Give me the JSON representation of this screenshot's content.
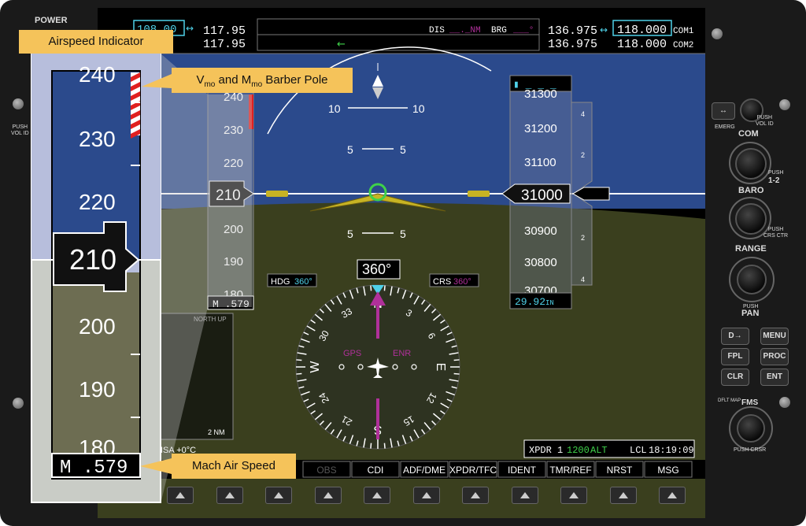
{
  "panel": {
    "power_label": "POWER",
    "push_vol_id_left": "PUSH\nVOL ID",
    "emerg_label": "EMERG",
    "push_vol_id_right": "PUSH\nVOL ID",
    "com_label": "COM",
    "push_1_2": "PUSH",
    "one_two": "1-2",
    "baro_label": "BARO",
    "push_crs_ctr": "PUSH\nCRS CTR",
    "range_label": "RANGE",
    "push_label": "PUSH",
    "pan_label": "PAN",
    "dflt_map": "DFLT MAP",
    "fms_label": "FMS",
    "push_crsr": "PUSH CRSR",
    "buttons": {
      "direct": "D→",
      "menu": "MENU",
      "fpl": "FPL",
      "proc": "PROC",
      "clr": "CLR",
      "ent": "ENT"
    }
  },
  "nav_bar": {
    "nav_active": "108.00",
    "nav1_standby": "117.95",
    "nav2_standby": "117.95",
    "dis_label": "DIS",
    "dis_value": "__._NM",
    "brg_label": "BRG",
    "brg_value": "___°",
    "com1_standby": "136.975",
    "com1_active": "118.000",
    "com1_label": "COM1",
    "com2_standby": "136.975",
    "com2_active": "118.000",
    "com2_label": "COM2"
  },
  "attitude": {
    "pitch_marks": [
      "10",
      "10",
      "5",
      "5",
      "5",
      "5"
    ]
  },
  "airspeed_tape": {
    "ticks": [
      "240",
      "230",
      "220",
      "200",
      "190",
      "180"
    ],
    "current": "210",
    "mach": "M .579"
  },
  "altitude_tape": {
    "selected": "_ _ _",
    "ticks": [
      "31300",
      "31200",
      "31100",
      "30900",
      "30800",
      "30700"
    ],
    "current": "31000",
    "baro": "29.92",
    "baro_unit": "IN",
    "vsi_ticks": [
      "4",
      "2",
      "2",
      "4"
    ]
  },
  "hsi": {
    "heading": "360°",
    "hdg_label": "HDG",
    "hdg_value": "360°",
    "crs_label": "CRS",
    "crs_value": "360°",
    "gps_label": "GPS",
    "enr_label": "ENR",
    "card": [
      "N",
      "3",
      "6",
      "E",
      "12",
      "15",
      "S",
      "21",
      "24",
      "W",
      "30",
      "33"
    ]
  },
  "inset_map": {
    "orientation": "NORTH UP",
    "range": "2 NM"
  },
  "status_bar": {
    "xpdr": "XPDR 1",
    "code": "1200",
    "mode": "ALT",
    "lcl_label": "LCL",
    "time": "18:19:09",
    "isa": "ISA",
    "temp": "+0°C"
  },
  "softkeys": [
    "OBS",
    "CDI",
    "ADF/DME",
    "XPDR/TFC",
    "IDENT",
    "TMR/REF",
    "NRST",
    "MSG"
  ],
  "callouts": {
    "airspeed_indicator": "Airspeed Indicator",
    "barber_pole_v": "V",
    "barber_pole_v_sub": "mo",
    "barber_pole_and": " and M",
    "barber_pole_m_sub": "mo",
    "barber_pole_rest": " Barber Pole",
    "mach_air_speed": "Mach Air Speed"
  },
  "zoom": {
    "ticks": [
      "240",
      "230",
      "220",
      "200",
      "190",
      "180"
    ],
    "current": "210",
    "mach": "M .579"
  },
  "colors": {
    "sky": "#2b4a8c",
    "ground": "#3a3f1e",
    "cyan": "#4fd1e8",
    "magenta": "#b0309a",
    "green": "#3fd24a",
    "callout": "#f5c35a",
    "barber_red": "#e02020"
  }
}
